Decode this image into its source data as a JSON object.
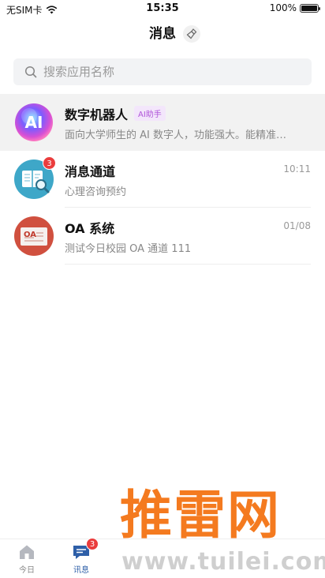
{
  "status_bar": {
    "carrier": "无SIM卡",
    "time": "15:35",
    "battery": "100%"
  },
  "header": {
    "title": "消息"
  },
  "search": {
    "placeholder": "搜索应用名称"
  },
  "messages": [
    {
      "title": "数字机器人",
      "badge": "AI助手",
      "subtitle": "面向大学师生的 AI 数字人，功能强大。能精准…",
      "time": ""
    },
    {
      "title": "消息通道",
      "subtitle": "心理咨询预约",
      "time": "10:11",
      "unread": "3"
    },
    {
      "title": "OA 系统",
      "subtitle": "测试今日校园 OA 通道 111",
      "time": "01/08",
      "avatar_text": "OA"
    }
  ],
  "tabs": [
    {
      "label": "今日"
    },
    {
      "label": "讯息",
      "badge": "3"
    }
  ],
  "watermark": {
    "text": "推雷网",
    "url": "www.tuilei.com"
  },
  "colors": {
    "accent": "#2e5fa8",
    "badge_red": "#ea3d3d",
    "ai_badge_text": "#b055d9",
    "watermark": "#f47a1f"
  }
}
